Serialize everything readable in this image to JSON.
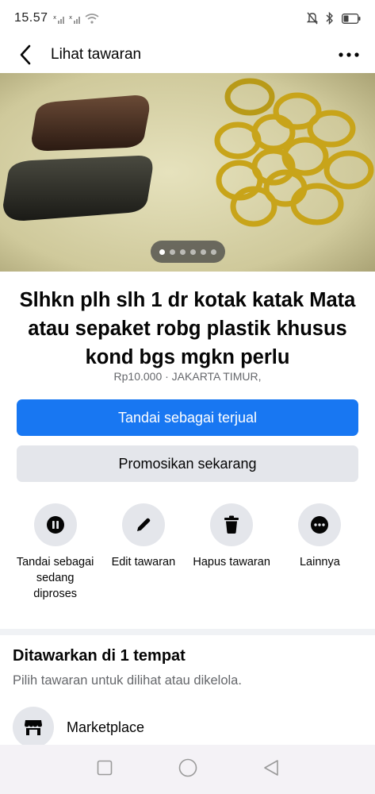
{
  "status_bar": {
    "time": "15.57",
    "icons": [
      "signal-x-icon",
      "signal-x-icon",
      "wifi-icon",
      "mute-icon",
      "bluetooth-icon",
      "battery-icon"
    ]
  },
  "header": {
    "title": "Lihat tawaran",
    "back_icon": "chevron-left-icon",
    "more_icon": "more-horizontal-icon"
  },
  "photo": {
    "image_count": 6,
    "active_index": 0
  },
  "listing": {
    "title": "Slhkn plh slh 1 dr kotak katak Mata atau sepaket robg plastik khusus kond bgs mgkn perlu",
    "meta": "Rp10.000 · JAKARTA TIMUR,"
  },
  "buttons": {
    "mark_sold": "Tandai sebagai terjual",
    "promote": "Promosikan sekarang"
  },
  "actions": [
    {
      "label": "Tandai sebagai sedang diproses",
      "icon": "pause-icon"
    },
    {
      "label": "Edit tawaran",
      "icon": "pencil-icon"
    },
    {
      "label": "Hapus tawaran",
      "icon": "trash-icon"
    },
    {
      "label": "Lainnya",
      "icon": "more-icon"
    }
  ],
  "offered": {
    "title": "Ditawarkan di 1 tempat",
    "subtitle": "Pilih tawaran untuk dilihat atau dikelola.",
    "places": [
      {
        "label": "Marketplace",
        "icon": "marketplace-shop-icon"
      }
    ]
  },
  "navbar": {
    "icons": [
      "recents-square-icon",
      "home-circle-icon",
      "back-triangle-icon"
    ]
  },
  "colors": {
    "primary": "#1877f2",
    "secondary_bg": "#e4e6eb",
    "muted_text": "#65676b"
  }
}
